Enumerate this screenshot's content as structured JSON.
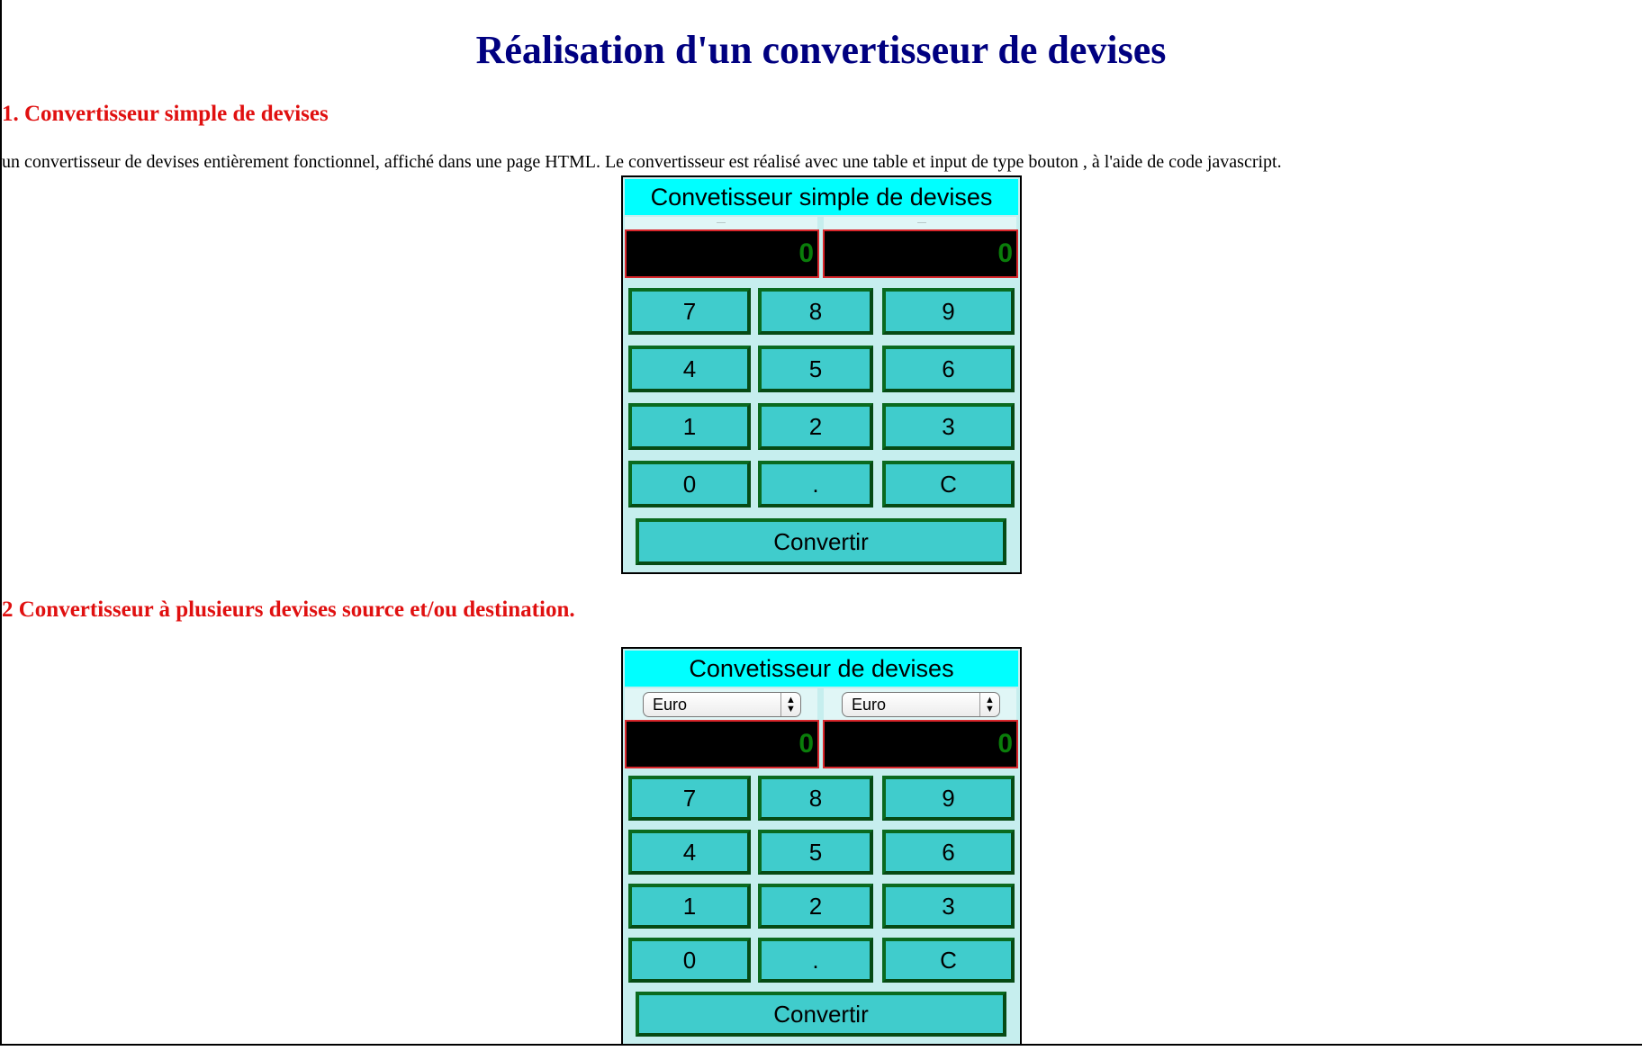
{
  "page": {
    "title": "Réalisation d'un convertisseur de devises",
    "section1_title": "1. Convertisseur simple de devises",
    "intro": "un convertisseur de devises entièrement fonctionnel, affiché dans une page HTML. Le convertisseur est réalisé avec une table et input de type bouton , à l'aide de code javascript.",
    "section2_title": "2 Convertisseur à plusieurs devises source et/ou destination."
  },
  "converter1": {
    "title": "Convetisseur simple de devises",
    "display_left": "0",
    "display_right": "0",
    "keys": [
      "7",
      "8",
      "9",
      "4",
      "5",
      "6",
      "1",
      "2",
      "3",
      "0",
      ".",
      "C"
    ],
    "convert_label": "Convertir"
  },
  "converter2": {
    "title": "Convetisseur de devises",
    "source_currency": "Euro",
    "target_currency": "Euro",
    "display_left": "0",
    "display_right": "0",
    "keys": [
      "7",
      "8",
      "9",
      "4",
      "5",
      "6",
      "1",
      "2",
      "3",
      "0",
      ".",
      "C"
    ],
    "convert_label": "Convertir"
  },
  "colors": {
    "heading": "#000080",
    "section": "#e01010",
    "title_bar": "#00ffff",
    "key": "#40cccc",
    "key_border": "#0a6a1f",
    "display_bg": "#000000",
    "display_text": "#0a7d0a"
  }
}
